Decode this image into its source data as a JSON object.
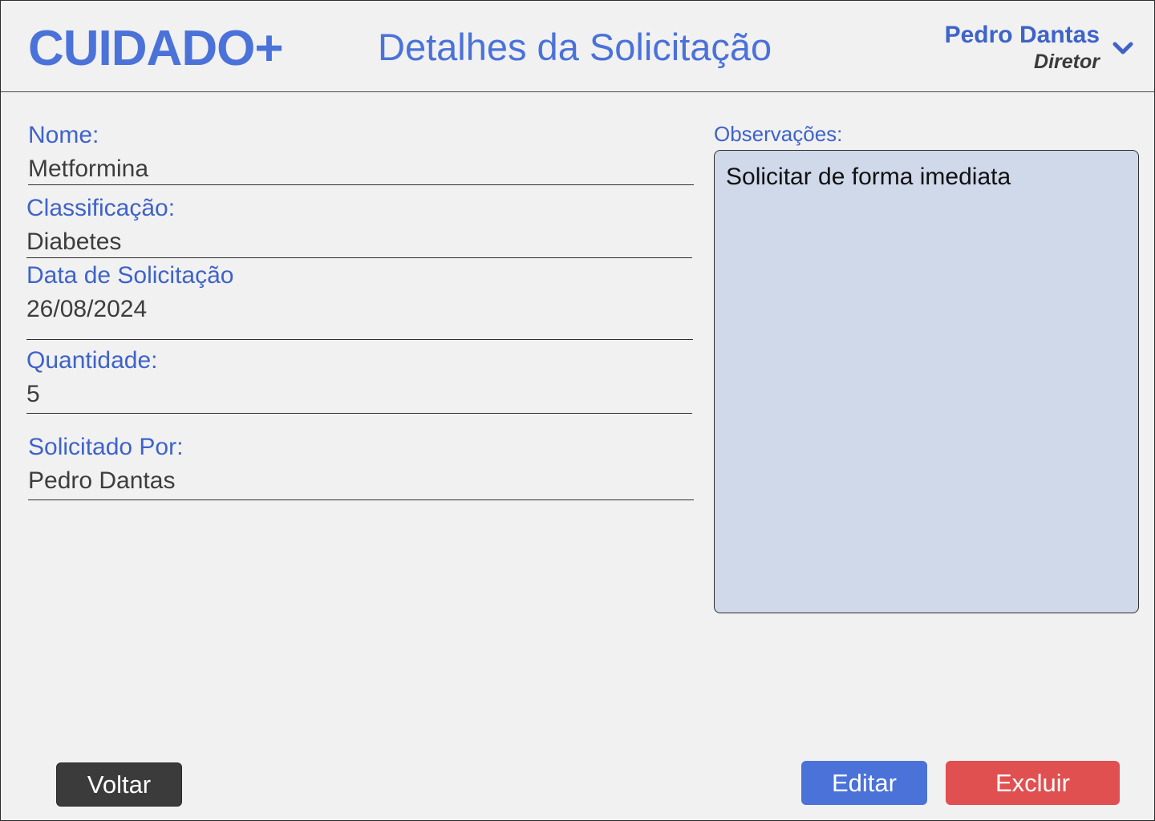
{
  "header": {
    "brand": "CUIDADO+",
    "title": "Detalhes da Solicitação",
    "user": {
      "name": "Pedro Dantas",
      "role": "Diretor",
      "menu_icon": "chevron-down-icon"
    }
  },
  "fields": {
    "nome": {
      "label": "Nome:",
      "value": "Metformina"
    },
    "classificacao": {
      "label": "Classificação:",
      "value": "Diabetes"
    },
    "data_solicitacao": {
      "label": "Data de Solicitação",
      "value": "26/08/2024"
    },
    "quantidade": {
      "label": "Quantidade:",
      "value": "5"
    },
    "solicitado_por": {
      "label": "Solicitado Por:",
      "value": "Pedro Dantas"
    }
  },
  "observacoes": {
    "label": "Observações:",
    "value": "Solicitar de forma imediata"
  },
  "actions": {
    "back_label": "Voltar",
    "edit_label": "Editar",
    "delete_label": "Excluir"
  },
  "colors": {
    "accent": "#4a72d9",
    "danger": "#e05050",
    "dark": "#3b3b3b",
    "notes_bg": "#cfd9ea",
    "background": "#f1f1f1"
  }
}
